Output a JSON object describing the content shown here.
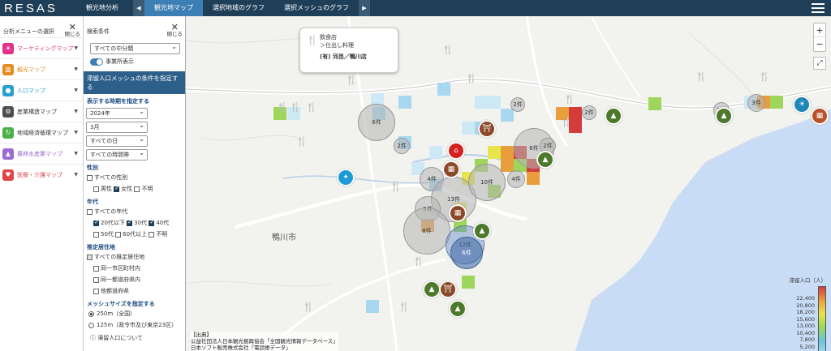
{
  "app": {
    "logo": "RESAS"
  },
  "tabs": [
    {
      "label": "観光地分析"
    },
    {
      "label": "観光地マップ"
    },
    {
      "label": "選択地域のグラフ"
    },
    {
      "label": "選択メッシュのグラフ"
    }
  ],
  "left_panel": {
    "title": "分析メニューの選択",
    "close": "閉じる",
    "items": [
      {
        "label": "マーケティングマップ",
        "color": "#e4308a"
      },
      {
        "label": "観光マップ",
        "color": "#e58b1f"
      },
      {
        "label": "人口マップ",
        "color": "#2a9fd0"
      },
      {
        "label": "産業構造マップ",
        "color": "#4d4d4d"
      },
      {
        "label": "地域経済循環マップ",
        "color": "#49b04a"
      },
      {
        "label": "農林水産業マップ",
        "color": "#9b6ad3"
      },
      {
        "label": "医療・介護マップ",
        "color": "#e0454a"
      }
    ]
  },
  "cond_panel": {
    "title": "検索条件",
    "close": "閉じる",
    "subcategory": "すべての中分類",
    "office_toggle": "事業所表示",
    "section": "滞留人口メッシュの条件を指定する",
    "period_title": "表示する時期を指定する",
    "year": "2024年",
    "month": "3月",
    "day": "すべての日",
    "time": "すべての時間帯",
    "gender_title": "性別",
    "gender_all": "すべての性別",
    "male": "男性",
    "female": "女性",
    "unknown": "不明",
    "age_title": "年代",
    "age_all": "すべての年代",
    "age_20": "20代以下",
    "age_30": "30代",
    "age_40": "40代",
    "age_50": "50代",
    "age_60": "60代以上",
    "age_unknown": "不明",
    "residence_title": "推定居住地",
    "res_all": "すべての推定居住地",
    "res_same_city": "同一市区町村内",
    "res_same_pref": "同一都道府県内",
    "res_other": "他都道府県",
    "mesh_title": "メッシュサイズを指定する",
    "mesh_250": "250m（全国）",
    "mesh_125": "125m（政令市及び東京23区）",
    "about": "滞留人口について"
  },
  "map": {
    "popup": {
      "line1": "飲食店",
      "line2": "＞仕出し料理",
      "line3": "(有) 河邑／鴨川店"
    },
    "city_label": "鴨川市",
    "source": {
      "line1": "【出典】",
      "line2": "公益社団法人日本観光振興協会「全国観光情報データベース」",
      "line3": "日本ソフト販売株式会社「電話帳データ」"
    },
    "legend_title": "滞留人口（人）",
    "legend_values": [
      "22,400",
      "20,800",
      "18,200",
      "15,600",
      "13,000",
      "10,400",
      "7,800",
      "5,200"
    ],
    "clusters": [
      {
        "label": "6件"
      },
      {
        "label": "2件"
      },
      {
        "label": "4件"
      },
      {
        "label": "13件"
      },
      {
        "label": "10件"
      },
      {
        "label": "5件"
      },
      {
        "label": "8件"
      },
      {
        "label": "12件"
      },
      {
        "label": "6件"
      },
      {
        "label": "6件"
      },
      {
        "label": "2件"
      },
      {
        "label": "4件"
      },
      {
        "label": "2件"
      },
      {
        "label": "2件"
      },
      {
        "label": "3件"
      },
      {
        "label": "2件"
      }
    ],
    "zoom_in": "+",
    "zoom_out": "−"
  },
  "colors": {
    "header": "#1f3f59",
    "active_tab": "#3d7fb5",
    "sea": "#c9dcf5"
  }
}
